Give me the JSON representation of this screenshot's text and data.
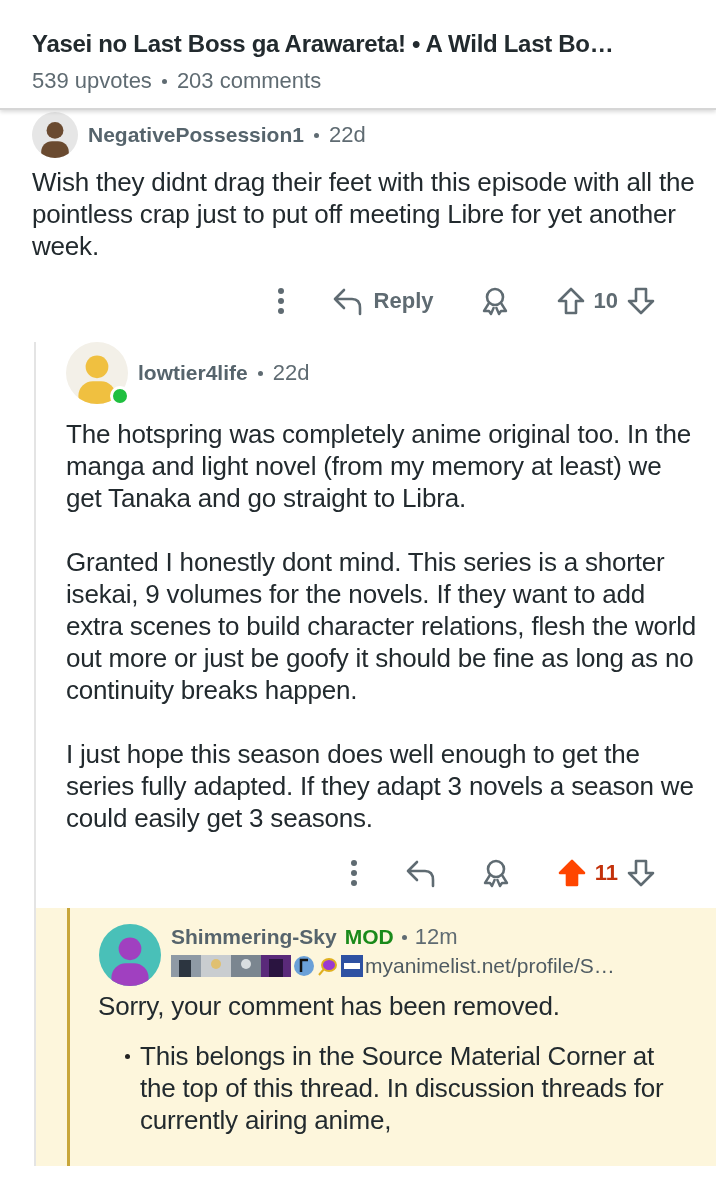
{
  "post": {
    "title": "Yasei no Last Boss ga Arawareta! • A Wild Last Bo…",
    "meta": [
      "539 upvotes",
      "203 comments"
    ]
  },
  "comments": [
    {
      "kind": "normal",
      "author": "NegativePossession1",
      "age": "22d",
      "paragraphs": [
        "Wish they didnt drag their feet with this episode with all the pointless crap just to put off meeting Libre for yet another week."
      ],
      "reply_label": "Reply",
      "score": "10",
      "upvoted": false
    },
    {
      "kind": "normal",
      "author": "lowtier4life",
      "age": "22d",
      "online": true,
      "paragraphs": [
        "The hotspring was completely anime original too. In the manga and light novel (from my memory at least) we get Tanaka and go straight to Libra.",
        "Granted I honestly dont mind. This series is a shorter isekai, 9 volumes for the novels. If they want to add extra scenes to build character relations, flesh the world out more or just be goofy it should be fine as long as no continuity breaks happen.",
        "I just hope this season does well enough to get the series fully adapted. If they adapt 3 novels a season we could easily get 3 seasons."
      ],
      "score": "11",
      "upvoted": true
    },
    {
      "kind": "mod",
      "author": "Shimmering-Sky",
      "badge": "MOD",
      "age": "12m",
      "flair": "myanimelist.net/profile/S…",
      "paragraphs": [
        "Sorry, your comment has been removed."
      ],
      "bullets": [
        "This belongs in the Source Material Corner at the top of this thread. In discussion threads for currently airing anime,"
      ]
    }
  ]
}
